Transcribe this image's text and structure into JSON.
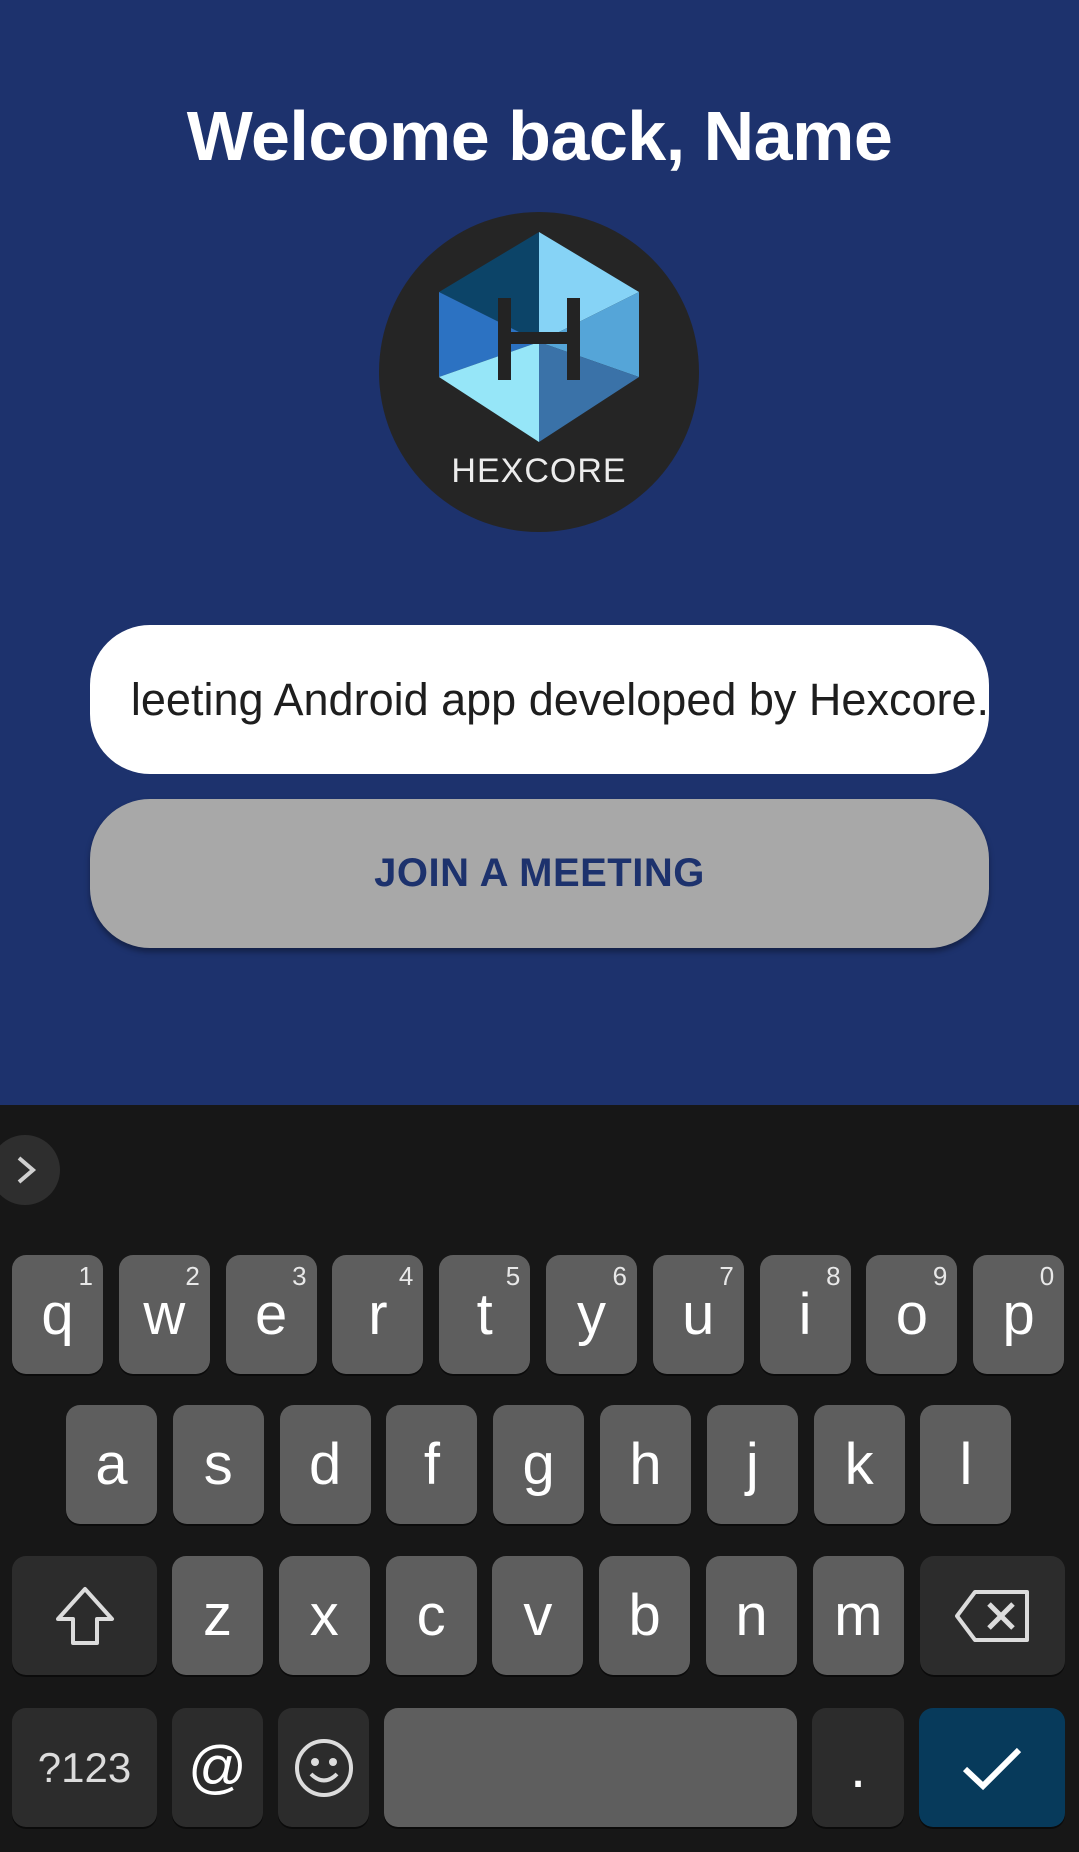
{
  "header": {
    "title": "Welcome back, Name"
  },
  "logo": {
    "text": "HEXCORE"
  },
  "meeting_input": {
    "value": "leeting Android app developed by Hexcore."
  },
  "join_button": {
    "label": "JOIN A MEETING"
  },
  "colors": {
    "background": "#1d326d",
    "button": "#a8a8a8",
    "button_text": "#1d326d",
    "keyboard": "#171717",
    "enter_key": "#073a5b"
  },
  "keyboard": {
    "row1": [
      {
        "label": "q",
        "hint": "1"
      },
      {
        "label": "w",
        "hint": "2"
      },
      {
        "label": "e",
        "hint": "3"
      },
      {
        "label": "r",
        "hint": "4"
      },
      {
        "label": "t",
        "hint": "5"
      },
      {
        "label": "y",
        "hint": "6"
      },
      {
        "label": "u",
        "hint": "7"
      },
      {
        "label": "i",
        "hint": "8"
      },
      {
        "label": "o",
        "hint": "9"
      },
      {
        "label": "p",
        "hint": "0"
      }
    ],
    "row2": [
      "a",
      "s",
      "d",
      "f",
      "g",
      "h",
      "j",
      "k",
      "l"
    ],
    "row3": [
      "z",
      "x",
      "c",
      "v",
      "b",
      "n",
      "m"
    ],
    "row4": {
      "symbols": "?123",
      "at": "@",
      "period": "."
    },
    "icons": [
      "chevron-right-icon",
      "shift-icon",
      "backspace-icon",
      "emoji-icon",
      "checkmark-icon"
    ]
  }
}
